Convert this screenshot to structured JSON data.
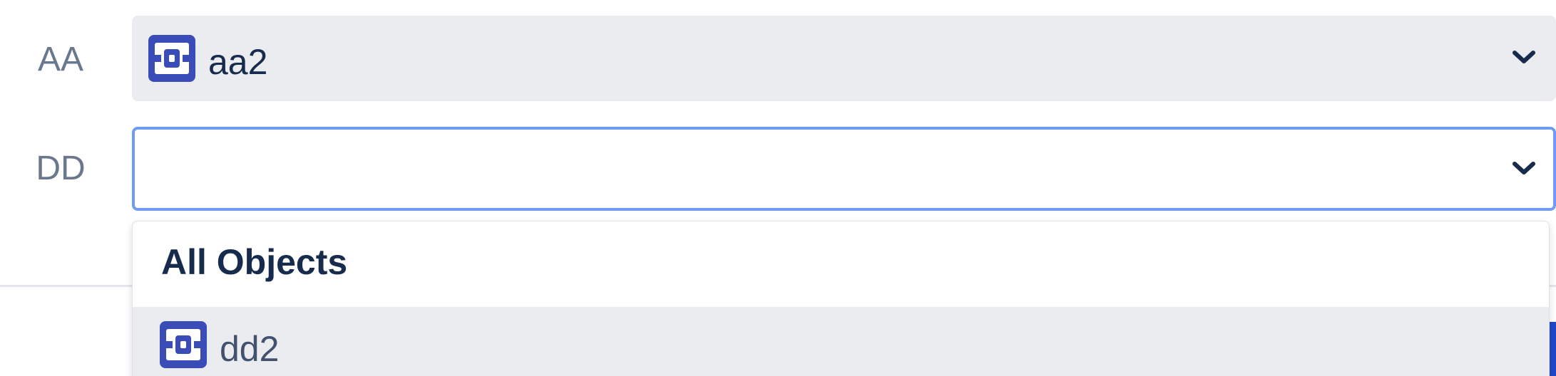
{
  "fields": [
    {
      "label": "AA",
      "selected_value": "aa2",
      "selected_icon": "object-icon"
    },
    {
      "label": "DD",
      "selected_value": "",
      "focused": true
    }
  ],
  "dropdown": {
    "group_header": "All Objects",
    "options": [
      {
        "label": "dd2",
        "icon": "object-icon",
        "highlighted": true
      }
    ]
  },
  "colors": {
    "label_text": "#6b778c",
    "value_text": "#172b4d",
    "select_bg": "#ebecf0",
    "focus_border": "#6f9cf0",
    "icon_blue": "#3a4cb8",
    "button_blue": "#1f48c8"
  }
}
